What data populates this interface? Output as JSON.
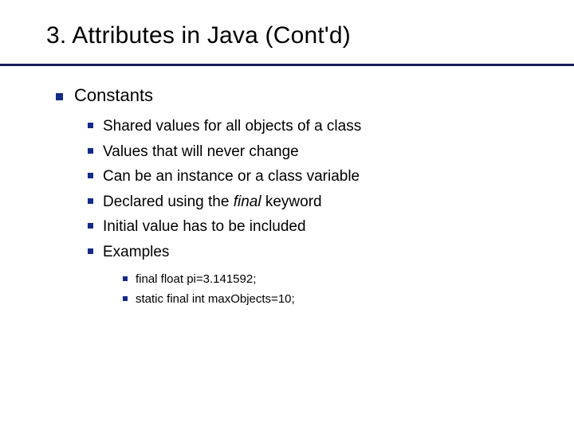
{
  "title": "3. Attributes in Java (Cont'd)",
  "main": {
    "heading": "Constants",
    "points": [
      "Shared values for all objects of a class",
      "Values that will never change",
      "Can be an instance or a class variable"
    ],
    "declared_prefix": "Declared using the ",
    "declared_keyword": "final",
    "declared_suffix": " keyword",
    "points2": [
      "Initial value has to be included",
      "Examples"
    ],
    "examples": [
      "final float pi=3.141592;",
      "static final int maxObjects=10;"
    ]
  }
}
